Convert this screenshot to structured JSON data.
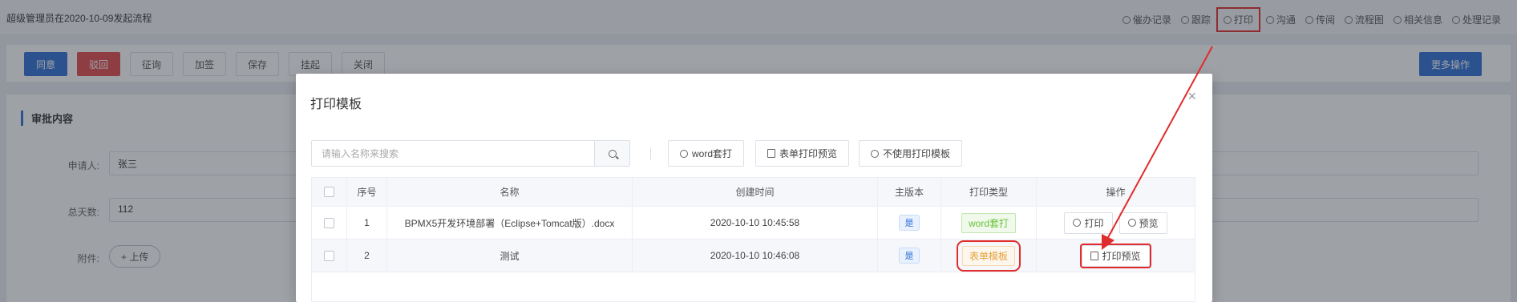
{
  "header": {
    "title": "超级管理员在2020-10-09发起流程",
    "links": [
      {
        "label": "催办记录",
        "icon": "clock-icon"
      },
      {
        "label": "跟踪",
        "icon": "plus-circle-icon"
      },
      {
        "label": "打印",
        "icon": "printer-icon"
      },
      {
        "label": "沟通",
        "icon": "chat-icon"
      },
      {
        "label": "传阅",
        "icon": "folder-icon"
      },
      {
        "label": "流程图",
        "icon": "play-icon"
      },
      {
        "label": "相关信息",
        "icon": "info-icon"
      },
      {
        "label": "处理记录",
        "icon": "history-icon"
      }
    ]
  },
  "toolbar": {
    "agree": "同意",
    "reject": "驳回",
    "consult": "征询",
    "countersign": "加签",
    "save": "保存",
    "suspend": "挂起",
    "close": "关闭",
    "more": "更多操作"
  },
  "form": {
    "section_title": "审批内容",
    "applicant_label": "申请人:",
    "applicant_value": "张三",
    "days_label": "总天数:",
    "days_value": "112",
    "attachment_label": "附件:",
    "upload_label": "+ 上传"
  },
  "modal": {
    "title": "打印模板",
    "close": "×",
    "search_placeholder": "请输入名称来搜索",
    "btn_word": "word套打",
    "btn_form_preview": "表单打印预览",
    "btn_no_template": "不使用打印模板",
    "columns": [
      "序号",
      "名称",
      "创建时间",
      "主版本",
      "打印类型",
      "操作"
    ],
    "rows": [
      {
        "index": "1",
        "name": "BPMX5开发环境部署（Eclipse+Tomcat版）.docx",
        "created": "2020-10-10 10:45:58",
        "main_version": "是",
        "print_type": "word套打",
        "ops": [
          "打印",
          "预览"
        ]
      },
      {
        "index": "2",
        "name": "测试",
        "created": "2020-10-10 10:46:08",
        "main_version": "是",
        "print_type": "表单模板",
        "ops": [
          "打印预览"
        ]
      }
    ]
  },
  "colors": {
    "primary": "#2f6fd6",
    "danger": "#e24b4b",
    "highlight": "#e02c2c"
  }
}
